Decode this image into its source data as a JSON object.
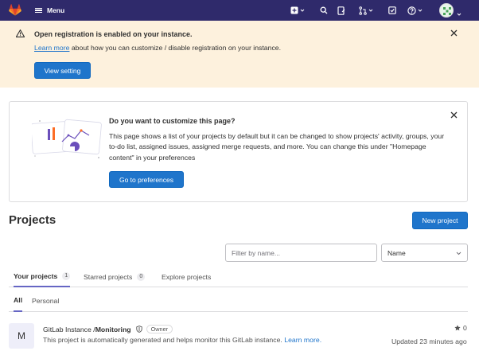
{
  "navbar": {
    "logo_icon": "gitlab-tanuki-logo",
    "menu_label": "Menu",
    "icons": [
      "plus-icon",
      "search-icon",
      "merge-request-icon",
      "issues-icon",
      "todo-icon",
      "help-icon"
    ],
    "brand_color": "#2f2a6b"
  },
  "registration_alert": {
    "icon": "warning-icon",
    "title": "Open registration is enabled on your instance.",
    "link_text": "Learn more",
    "body_text": " about how you can customize / disable registration on your instance.",
    "button_label": "View setting",
    "background": "#fdf1dd"
  },
  "customize_card": {
    "title": "Do you want to customize this page?",
    "description": "This page shows a list of your projects by default but it can be changed to show projects' activity, groups, your to-do list, assigned issues, assigned merge requests, and more. You can change this under \"Homepage content\" in your preferences",
    "button_label": "Go to preferences"
  },
  "projects_page": {
    "title": "Projects",
    "new_project_label": "New project",
    "filter_placeholder": "Filter by name...",
    "sort_selected": "Name",
    "tabs": [
      {
        "label": "Your projects",
        "count": "1",
        "active": true
      },
      {
        "label": "Starred projects",
        "count": "0",
        "active": false
      },
      {
        "label": "Explore projects",
        "active": false
      }
    ],
    "subtabs": [
      {
        "label": "All",
        "active": true
      },
      {
        "label": "Personal",
        "active": false
      }
    ],
    "projects": [
      {
        "avatar_letter": "M",
        "namespace": "GitLab Instance / ",
        "name": "Monitoring",
        "visibility_icon": "shield-icon",
        "role": "Owner",
        "description": "This project is automatically generated and helps monitor this GitLab instance. ",
        "description_link": "Learn more.",
        "stars": "0",
        "updated": "Updated 23 minutes ago"
      }
    ]
  },
  "colors": {
    "primary": "#1f75cb",
    "tab_underline": "#6666c4"
  }
}
